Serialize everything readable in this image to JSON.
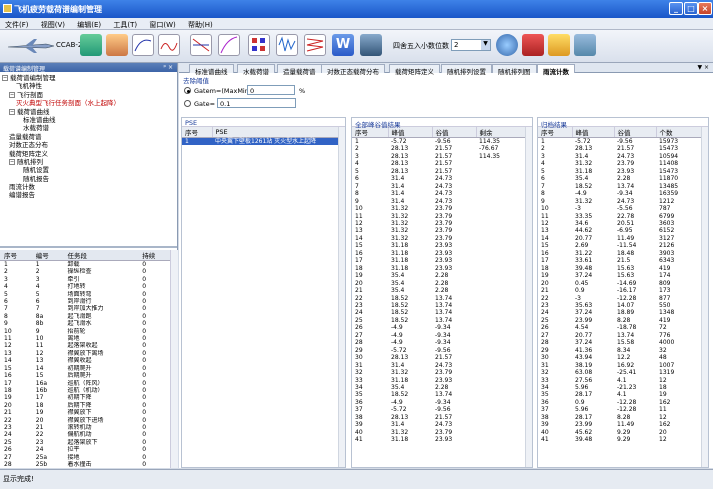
{
  "window": {
    "title": "飞机疲劳载荷谱编制管理"
  },
  "menu": [
    "文件(F)",
    "视图(V)",
    "编辑(E)",
    "工具(T)",
    "窗口(W)",
    "帮助(H)"
  ],
  "toolbar": {
    "model_label": "CCAB-25",
    "decimal_label": "四舍五入小数位数",
    "decimal_value": "2"
  },
  "left_panel": {
    "title": "载荷谱编制管理",
    "tree": [
      {
        "label": "载荷谱编制管理",
        "indent": 0,
        "exp": "⊟"
      },
      {
        "label": "飞机神性",
        "indent": 2,
        "exp": ""
      },
      {
        "label": "飞行剖面",
        "indent": 1,
        "exp": "⊟"
      },
      {
        "label": "灭火典型飞行任务剖面（水上起降）",
        "indent": 2,
        "exp": "",
        "red": true
      },
      {
        "label": "载荷谱曲线",
        "indent": 1,
        "exp": "⊟"
      },
      {
        "label": "标准谱曲线",
        "indent": 3,
        "exp": ""
      },
      {
        "label": "水载荷谱",
        "indent": 3,
        "exp": ""
      },
      {
        "label": "造量载荷谱",
        "indent": 1,
        "exp": ""
      },
      {
        "label": "对数正态分布",
        "indent": 1,
        "exp": ""
      },
      {
        "label": "载荷矩阵定义",
        "indent": 1,
        "exp": ""
      },
      {
        "label": "随机排列",
        "indent": 1,
        "exp": "⊟"
      },
      {
        "label": "随机设置",
        "indent": 3,
        "exp": ""
      },
      {
        "label": "随机报告",
        "indent": 3,
        "exp": ""
      },
      {
        "label": "雨流计数",
        "indent": 1,
        "exp": ""
      },
      {
        "label": "编谱报告",
        "indent": 1,
        "exp": ""
      }
    ],
    "grid_headers": [
      "序号",
      "编号",
      "任务段",
      "持续"
    ],
    "grid_rows": [
      [
        "1",
        "1",
        "卸载",
        "0"
      ],
      [
        "2",
        "2",
        "操纵检查",
        "0"
      ],
      [
        "3",
        "3",
        "牵引",
        "0"
      ],
      [
        "4",
        "4",
        "打地转",
        "0"
      ],
      [
        "5",
        "5",
        "场面转弯",
        "0"
      ],
      [
        "6",
        "6",
        "到岸滑行",
        "0"
      ],
      [
        "7",
        "7",
        "到岸加大推力",
        "0"
      ],
      [
        "8",
        "8a",
        "起飞滑跑",
        "0"
      ],
      [
        "9",
        "8b",
        "起飞滑水",
        "0"
      ],
      [
        "10",
        "9",
        "抬前轮",
        "0"
      ],
      [
        "11",
        "10",
        "离地",
        "0"
      ],
      [
        "12",
        "11",
        "起落架收起",
        "0"
      ],
      [
        "13",
        "12",
        "襟翼放下离场",
        "0"
      ],
      [
        "14",
        "13",
        "襟翼收起",
        "0"
      ],
      [
        "15",
        "14",
        "初期爬升",
        "0"
      ],
      [
        "16",
        "15",
        "后期爬升",
        "0"
      ],
      [
        "17",
        "16a",
        "巡航（阵风）",
        "0"
      ],
      [
        "18",
        "16b",
        "巡航（机动）",
        "0"
      ],
      [
        "19",
        "17",
        "初期下降",
        "0"
      ],
      [
        "20",
        "18",
        "后期下降",
        "0"
      ],
      [
        "21",
        "19",
        "襟翼放下",
        "0"
      ],
      [
        "22",
        "20",
        "襟翼放下进场",
        "0"
      ],
      [
        "23",
        "21",
        "滚转机动",
        "0"
      ],
      [
        "24",
        "22",
        "偏航机动",
        "0"
      ],
      [
        "25",
        "23",
        "起落架放下",
        "0"
      ],
      [
        "26",
        "24",
        "拉平",
        "0"
      ],
      [
        "27",
        "25a",
        "接地",
        "0"
      ],
      [
        "28",
        "25b",
        "着水撞击",
        "0"
      ],
      [
        "29",
        "26a",
        "着陆滑跑",
        "0"
      ]
    ]
  },
  "tabs": [
    "标准谱曲线",
    "水载荷谱",
    "造量载荷谱",
    "对数正态载荷分布",
    "载荷矩阵定义",
    "随机排列设置",
    "随机排列图",
    "雨流计数"
  ],
  "active_tab": 7,
  "threshold": {
    "title": "去除阈值",
    "option1": "Gatem=(MaxMin) ≤",
    "option1_value": "0",
    "unit": "%",
    "option2": "Gate=",
    "option2_value": "0.1"
  },
  "pse_panel": {
    "title": "PSE",
    "headers": [
      "序号",
      "PSE"
    ],
    "rows": [
      [
        "1",
        "中央翼下壁板1261站 灭火型水上起降"
      ]
    ]
  },
  "peak_panel": {
    "title": "全部峰谷值结果",
    "headers": [
      "序号",
      "峰值",
      "谷值",
      "剩余"
    ],
    "rows": [
      [
        "1",
        "-5.72",
        "-9.56",
        "114.35"
      ],
      [
        "2",
        "28.13",
        "21.57",
        "-76.67"
      ],
      [
        "3",
        "28.13",
        "21.57",
        "114.35"
      ],
      [
        "4",
        "28.13",
        "21.57",
        ""
      ],
      [
        "5",
        "28.13",
        "21.57",
        ""
      ],
      [
        "6",
        "31.4",
        "24.73",
        ""
      ],
      [
        "7",
        "31.4",
        "24.73",
        ""
      ],
      [
        "8",
        "31.4",
        "24.73",
        ""
      ],
      [
        "9",
        "31.4",
        "24.73",
        ""
      ],
      [
        "10",
        "31.32",
        "23.79",
        ""
      ],
      [
        "11",
        "31.32",
        "23.79",
        ""
      ],
      [
        "12",
        "31.32",
        "23.79",
        ""
      ],
      [
        "13",
        "31.32",
        "23.79",
        ""
      ],
      [
        "14",
        "31.32",
        "23.79",
        ""
      ],
      [
        "15",
        "31.18",
        "23.93",
        ""
      ],
      [
        "16",
        "31.18",
        "23.93",
        ""
      ],
      [
        "17",
        "31.18",
        "23.93",
        ""
      ],
      [
        "18",
        "31.18",
        "23.93",
        ""
      ],
      [
        "19",
        "35.4",
        "2.28",
        ""
      ],
      [
        "20",
        "35.4",
        "2.28",
        ""
      ],
      [
        "21",
        "35.4",
        "2.28",
        ""
      ],
      [
        "22",
        "18.52",
        "13.74",
        ""
      ],
      [
        "23",
        "18.52",
        "13.74",
        ""
      ],
      [
        "24",
        "18.52",
        "13.74",
        ""
      ],
      [
        "25",
        "18.52",
        "13.74",
        ""
      ],
      [
        "26",
        "-4.9",
        "-9.34",
        ""
      ],
      [
        "27",
        "-4.9",
        "-9.34",
        ""
      ],
      [
        "28",
        "-4.9",
        "-9.34",
        ""
      ],
      [
        "29",
        "-5.72",
        "-9.56",
        ""
      ],
      [
        "30",
        "28.13",
        "21.57",
        ""
      ],
      [
        "31",
        "31.4",
        "24.73",
        ""
      ],
      [
        "32",
        "31.32",
        "23.79",
        ""
      ],
      [
        "33",
        "31.18",
        "23.93",
        ""
      ],
      [
        "34",
        "35.4",
        "2.28",
        ""
      ],
      [
        "35",
        "18.52",
        "13.74",
        ""
      ],
      [
        "36",
        "-4.9",
        "-9.34",
        ""
      ],
      [
        "37",
        "-5.72",
        "-9.56",
        ""
      ],
      [
        "38",
        "28.13",
        "21.57",
        ""
      ],
      [
        "39",
        "31.4",
        "24.73",
        ""
      ],
      [
        "40",
        "31.32",
        "23.79",
        ""
      ],
      [
        "41",
        "31.18",
        "23.93",
        ""
      ]
    ]
  },
  "class_panel": {
    "title": "归档结果",
    "headers": [
      "序号",
      "峰值",
      "谷值",
      "个数"
    ],
    "rows": [
      [
        "1",
        "-5.72",
        "-9.56",
        "15973"
      ],
      [
        "2",
        "28.13",
        "21.57",
        "15473"
      ],
      [
        "3",
        "31.4",
        "24.73",
        "10594"
      ],
      [
        "4",
        "31.32",
        "23.79",
        "11408"
      ],
      [
        "5",
        "31.18",
        "23.93",
        "15473"
      ],
      [
        "6",
        "35.4",
        "2.28",
        "11870"
      ],
      [
        "7",
        "18.52",
        "13.74",
        "13485"
      ],
      [
        "8",
        "-4.9",
        "-9.34",
        "16359"
      ],
      [
        "9",
        "31.32",
        "24.73",
        "1212"
      ],
      [
        "10",
        "-3",
        "-5.56",
        "787"
      ],
      [
        "11",
        "33.35",
        "22.78",
        "6799"
      ],
      [
        "12",
        "34.6",
        "20.51",
        "3603"
      ],
      [
        "13",
        "44.62",
        "-6.95",
        "6152"
      ],
      [
        "14",
        "20.77",
        "11.49",
        "3127"
      ],
      [
        "15",
        "2.69",
        "-11.54",
        "2126"
      ],
      [
        "16",
        "31.22",
        "18.48",
        "3903"
      ],
      [
        "17",
        "33.61",
        "21.5",
        "6343"
      ],
      [
        "18",
        "39.48",
        "15.63",
        "419"
      ],
      [
        "19",
        "37.24",
        "15.63",
        "174"
      ],
      [
        "20",
        "0.45",
        "-14.69",
        "809"
      ],
      [
        "21",
        "0.9",
        "-16.17",
        "173"
      ],
      [
        "22",
        "-3",
        "-12.28",
        "877"
      ],
      [
        "23",
        "35.63",
        "14.07",
        "550"
      ],
      [
        "24",
        "37.24",
        "18.89",
        "1348"
      ],
      [
        "25",
        "23.99",
        "8.28",
        "419"
      ],
      [
        "26",
        "4.54",
        "-18.78",
        "72"
      ],
      [
        "27",
        "20.77",
        "13.74",
        "776"
      ],
      [
        "28",
        "37.24",
        "15.58",
        "4000"
      ],
      [
        "29",
        "41.36",
        "8.34",
        "32"
      ],
      [
        "30",
        "43.94",
        "12.2",
        "48"
      ],
      [
        "31",
        "38.19",
        "16.92",
        "1007"
      ],
      [
        "32",
        "63.08",
        "-25.41",
        "1319"
      ],
      [
        "33",
        "27.56",
        "4.1",
        "12"
      ],
      [
        "34",
        "5.96",
        "-21.23",
        "18"
      ],
      [
        "35",
        "28.17",
        "4.1",
        "19"
      ],
      [
        "36",
        "0.9",
        "-12.28",
        "162"
      ],
      [
        "37",
        "5.96",
        "-12.28",
        "11"
      ],
      [
        "38",
        "28.17",
        "8.28",
        "12"
      ],
      [
        "39",
        "23.99",
        "11.49",
        "162"
      ],
      [
        "40",
        "45.62",
        "9.29",
        "20"
      ],
      [
        "41",
        "39.48",
        "9.29",
        "12"
      ]
    ]
  },
  "status": {
    "text": "显示完成!"
  }
}
